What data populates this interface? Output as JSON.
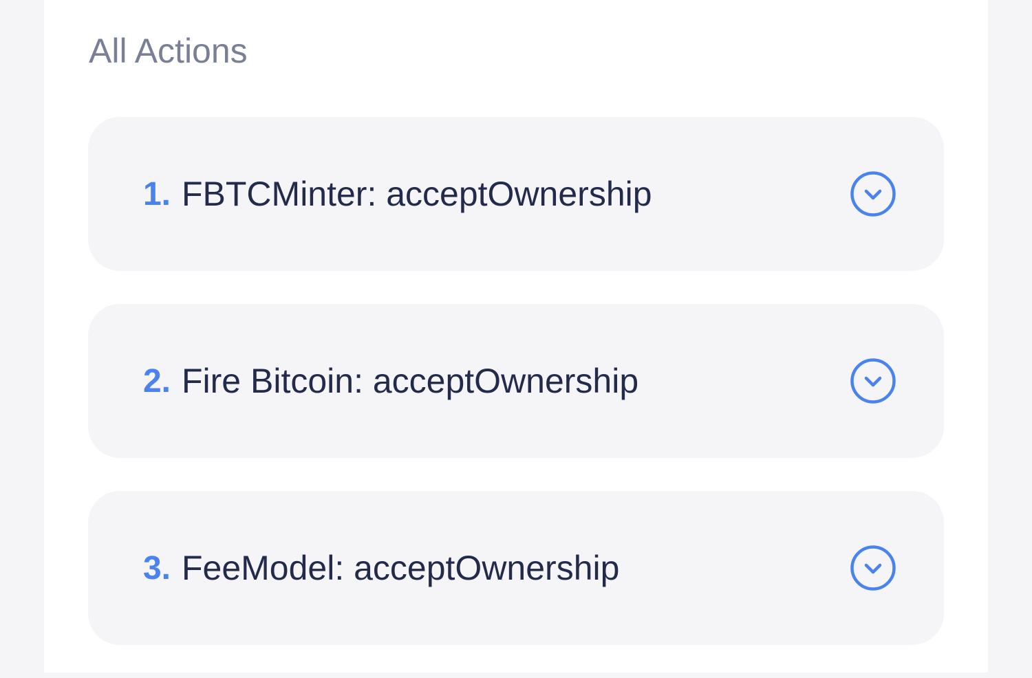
{
  "section": {
    "title": "All Actions"
  },
  "actions": [
    {
      "number": "1.",
      "label": "FBTCMinter: acceptOwnership"
    },
    {
      "number": "2.",
      "label": "Fire Bitcoin: acceptOwnership"
    },
    {
      "number": "3.",
      "label": "FeeModel: acceptOwnership"
    }
  ],
  "icons": {
    "expand": "chevron-down-circle-icon"
  },
  "colors": {
    "accent": "#4a82ee",
    "text": "#232a4a",
    "muted": "#7a7f96",
    "card_bg": "#f5f5f8",
    "panel_bg": "#ffffff"
  }
}
